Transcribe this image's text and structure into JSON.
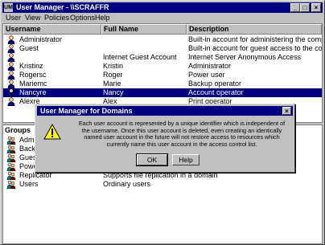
{
  "window": {
    "title": "User Manager - \\\\SCRAFFR",
    "app_icon_text": "UM",
    "min_glyph": "_",
    "max_glyph": "□",
    "close_glyph": "×"
  },
  "menu": {
    "items": [
      "User",
      "View",
      "Policies",
      "Options",
      "Help"
    ]
  },
  "users": {
    "headers": {
      "username": "Username",
      "fullname": "Full Name",
      "description": "Description"
    },
    "rows": [
      {
        "username": "Administrator",
        "fullname": "",
        "description": "Built-in account for administering the compu"
      },
      {
        "username": "Guest",
        "fullname": "",
        "description": "Built-in account for guest access to the con"
      },
      {
        "username": "",
        "fullname": "Internet Guest Account",
        "description": "Internet Server Anonymous Access"
      },
      {
        "username": "Kristinz",
        "fullname": "Kristin",
        "description": "Administrator"
      },
      {
        "username": "Rogersc",
        "fullname": "Roger",
        "description": "Power user"
      },
      {
        "username": "Mariemc",
        "fullname": "Marie",
        "description": "Backup operator"
      },
      {
        "username": "Nancyre",
        "fullname": "Nancy",
        "description": "Account operator"
      },
      {
        "username": "Alexre",
        "fullname": "Alex",
        "description": "Print operator"
      }
    ],
    "selected_index": 6
  },
  "groups": {
    "header": "Groups",
    "rows": [
      {
        "name": "Admi",
        "description": ""
      },
      {
        "name": "Back",
        "description": ""
      },
      {
        "name": "Guests",
        "description": "Users granted guest access to the computer/domain"
      },
      {
        "name": "Power Users",
        "description": "Members can share directories and printers"
      },
      {
        "name": "Replicator",
        "description": "Supports file replication in a domain"
      },
      {
        "name": "Users",
        "description": "Ordinary users"
      }
    ]
  },
  "dialog": {
    "title": "User Manager for Domains",
    "close_glyph": "×",
    "message": "Each user account is represented by a unique identifier which is independent of the username.  Once this user account is deleted, even creating an identically named user account in the future will not restore access to resources which currently name this user account in the access control list.",
    "ok_label": "OK",
    "cancel_label": "Cancel",
    "help_label": "Help"
  },
  "colors": {
    "titlebar": "#000080",
    "selection": "#000080",
    "face": "#c0c0c0",
    "warning": "#ffff00"
  }
}
